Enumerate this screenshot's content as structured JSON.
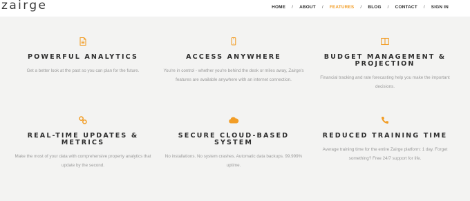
{
  "header": {
    "logo": "zairge",
    "nav": [
      {
        "label": "HOME",
        "active": false
      },
      {
        "label": "ABOUT",
        "active": false
      },
      {
        "label": "FEATURES",
        "active": true
      },
      {
        "label": "BLOG",
        "active": false
      },
      {
        "label": "CONTACT",
        "active": false
      },
      {
        "label": "SIGN IN",
        "active": false
      }
    ],
    "separator": "/"
  },
  "colors": {
    "accent": "#f29d26",
    "background": "#f3f3f2",
    "title": "#2e2e2e",
    "text": "#9a9a9a"
  },
  "features": [
    {
      "icon": "document-icon",
      "title": "POWERFUL ANALYTICS",
      "description": "Get a better look at the past so you can plan for the future."
    },
    {
      "icon": "mobile-phone-icon",
      "title": "ACCESS ANYWHERE",
      "description": "You're in control - whether you're behind the desk or miles away, Zairge's features are available anywhere with an internet connection."
    },
    {
      "icon": "book-open-icon",
      "title": "BUDGET MANAGEMENT & PROJECTION",
      "description": "Financial tracking and rate forecasting help you make the important decisions."
    },
    {
      "icon": "link-icon",
      "title": "REAL-TIME UPDATES & METRICS",
      "description": "Make the most of your data with comprehensive property analytics that update by the second."
    },
    {
      "icon": "cloud-icon",
      "title": "SECURE CLOUD-BASED SYSTEM",
      "description": "No installations. No system crashes. Automatic data backups. 99.999% uptime."
    },
    {
      "icon": "phone-icon",
      "title": "REDUCED TRAINING TIME",
      "description": "Average training time for the entire Zairge platform: 1 day. Forget something? Free 24/7 support for life."
    }
  ]
}
